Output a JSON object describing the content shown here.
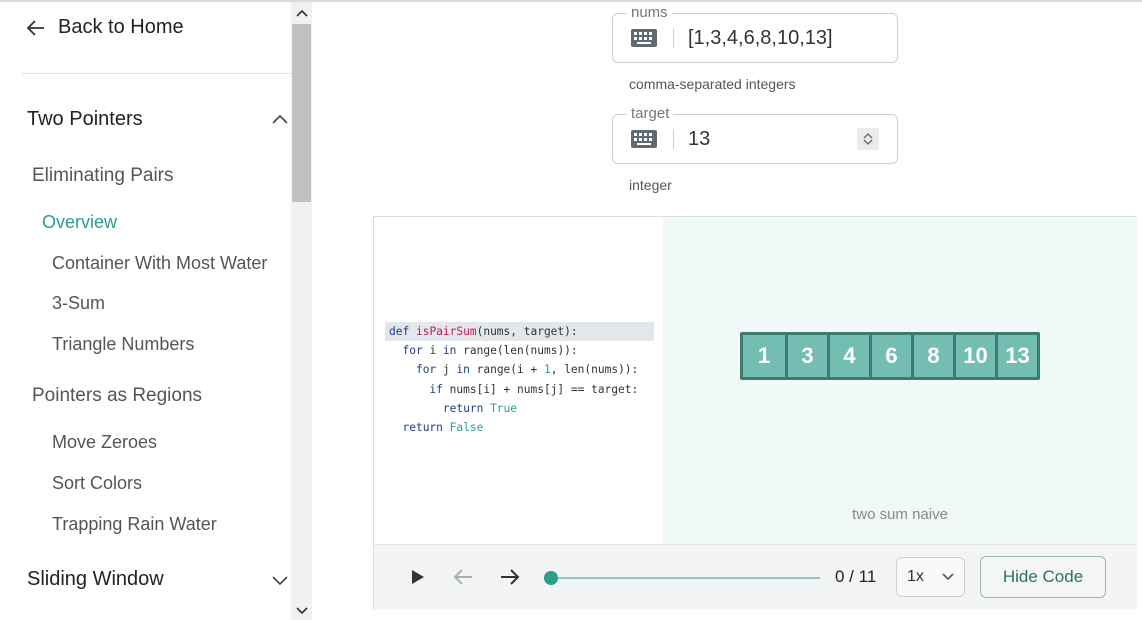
{
  "sidebar": {
    "back_label": "Back to Home",
    "sections": [
      {
        "label": "Two Pointers",
        "expanded": true
      },
      {
        "label": "Sliding Window",
        "expanded": false
      }
    ],
    "groups": [
      {
        "title": "Eliminating Pairs",
        "items": [
          "Overview",
          "Container With Most Water",
          "3-Sum",
          "Triangle Numbers"
        ]
      },
      {
        "title": "Pointers as Regions",
        "items": [
          "Move Zeroes",
          "Sort Colors",
          "Trapping Rain Water"
        ]
      }
    ],
    "active_item": "Overview"
  },
  "inputs": {
    "nums": {
      "label": "nums",
      "value": "[1,3,4,6,8,10,13]",
      "helper": "comma-separated integers"
    },
    "target": {
      "label": "target",
      "value": "13",
      "helper": "integer"
    }
  },
  "code": {
    "lines": [
      "def isPairSum(nums, target):",
      "  for i in range(len(nums)):",
      "    for j in range(i + 1, len(nums)):",
      "      if nums[i] + nums[j] == target:",
      "        return True",
      "  return False"
    ],
    "highlighted_line": 0
  },
  "visualization": {
    "array": [
      "1",
      "3",
      "4",
      "6",
      "8",
      "10",
      "13"
    ],
    "caption": "two sum naive",
    "cell_color": "#74bdb2",
    "border_color": "#3e7a6d"
  },
  "controls": {
    "step_counter": "0 / 11",
    "progress": 0,
    "speed": "1x",
    "hide_code_label": "Hide Code"
  },
  "colors": {
    "accent": "#2a9d8f"
  }
}
